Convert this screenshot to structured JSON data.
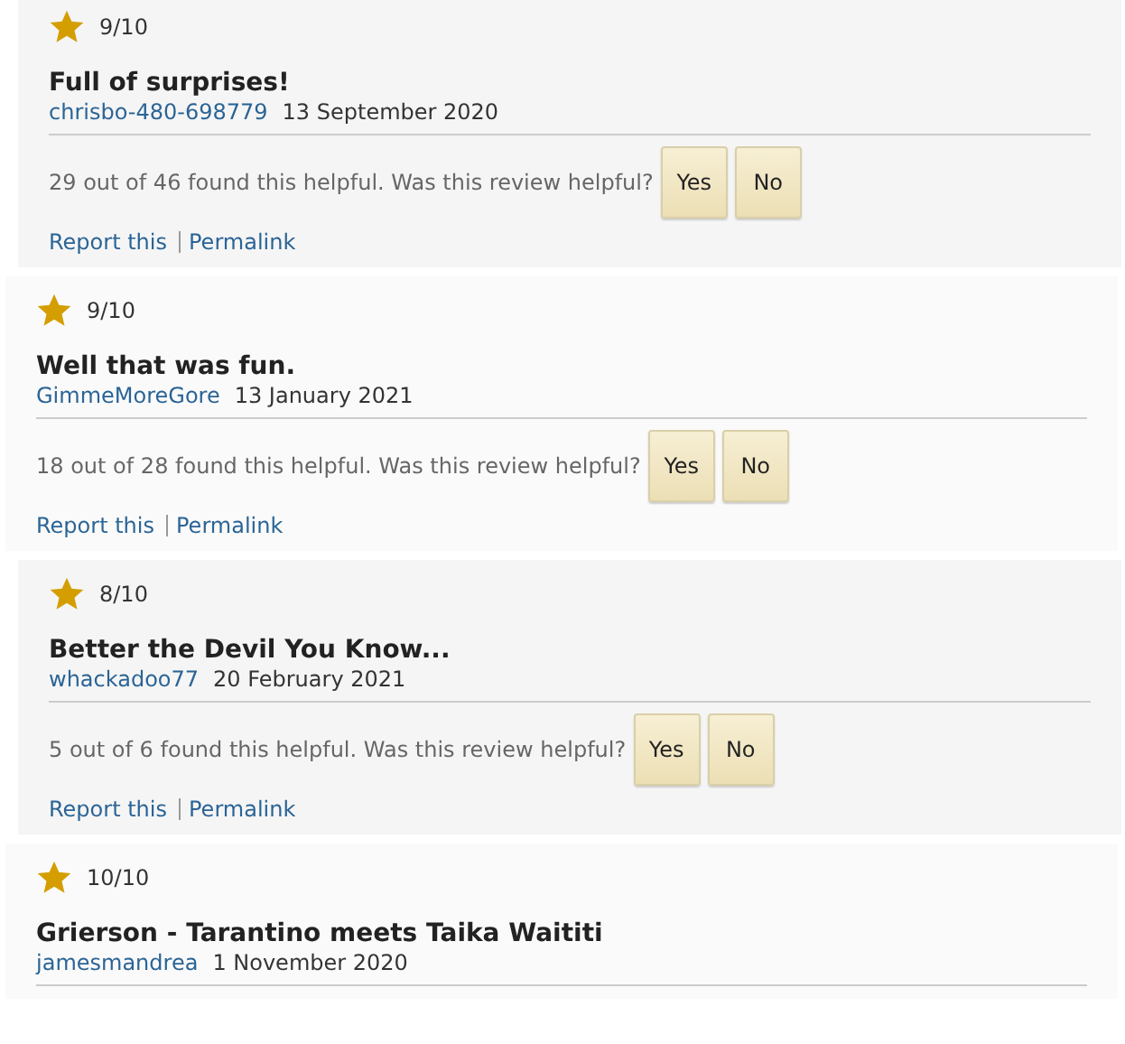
{
  "reviews": [
    {
      "rating": "9/10",
      "title": "Full of surprises!",
      "author": "chrisbo-480-698779",
      "date": "13 September 2020",
      "helpful": "29 out of 46 found this helpful. Was this review helpful?",
      "buttons": [
        "Yes",
        "No"
      ],
      "links": [
        "Report this",
        "Permalink"
      ]
    },
    {
      "rating": "9/10",
      "title": "Well that was fun.",
      "author": "GimmeMoreGore",
      "date": "13 January 2021",
      "helpful": "18 out of 28 found this helpful. Was this review helpful?",
      "buttons": [
        "Yes",
        "No"
      ],
      "links": [
        "Report this",
        "Permalink"
      ]
    },
    {
      "rating": "8/10",
      "title": "Better the Devil You Know...",
      "author": "whackadoo77",
      "date": "20 February 2021",
      "helpful": "5 out of 6 found this helpful. Was this review helpful?",
      "buttons": [
        "Yes",
        "No"
      ],
      "links": [
        "Report this",
        "Permalink"
      ]
    },
    {
      "rating": "10/10",
      "title": "Grierson - Tarantino meets Taika Waititi",
      "author": "jamesmandrea",
      "date": "1 November 2020"
    }
  ]
}
